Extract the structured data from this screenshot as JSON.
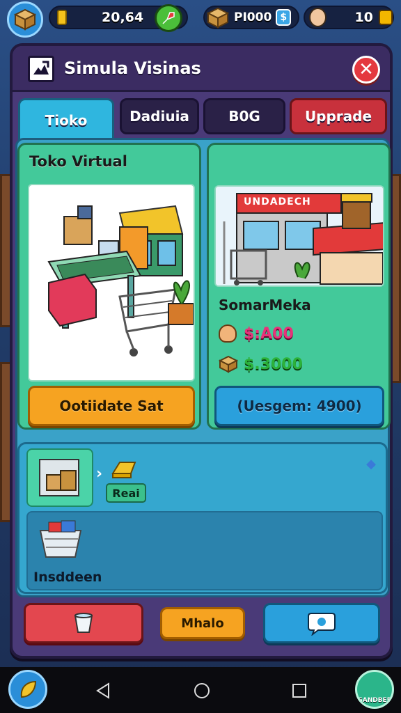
{
  "status_bar": {
    "coins": "20,64",
    "currency": "PI000",
    "level": "10"
  },
  "window": {
    "title": "Simula Visinas",
    "close_icon": "close-icon"
  },
  "tabs": [
    {
      "label": "Tioko",
      "active": true
    },
    {
      "label": "Dadiuia",
      "active": false
    },
    {
      "label": "B0G",
      "active": false
    },
    {
      "label": "Upprade",
      "active": false
    }
  ],
  "left_card": {
    "title": "Toko Virtual",
    "button": "Ootiidate Sat"
  },
  "right_card": {
    "store_sign": "UNDADECH",
    "name": "SomarMeka",
    "price_pink": "$:A00",
    "price_green": "$.3000",
    "button": "(Uesgem: 4900)"
  },
  "inventory": {
    "tag": "Reai",
    "label": "Insddeen"
  },
  "bottom_buttons": {
    "middle": "Mhalo"
  },
  "nav": {
    "corner_label": "GANDBER"
  },
  "colors": {
    "tab_active": "#2fb6df",
    "tab_dark": "#2a2147",
    "tab_upgrade": "#c8313c",
    "green_card": "#43c99a",
    "orange_btn": "#f6a321",
    "blue_btn": "#2aa0dc",
    "red_btn": "#e3474f",
    "price_pink": "#e8327a",
    "price_green": "#2cb23a"
  }
}
